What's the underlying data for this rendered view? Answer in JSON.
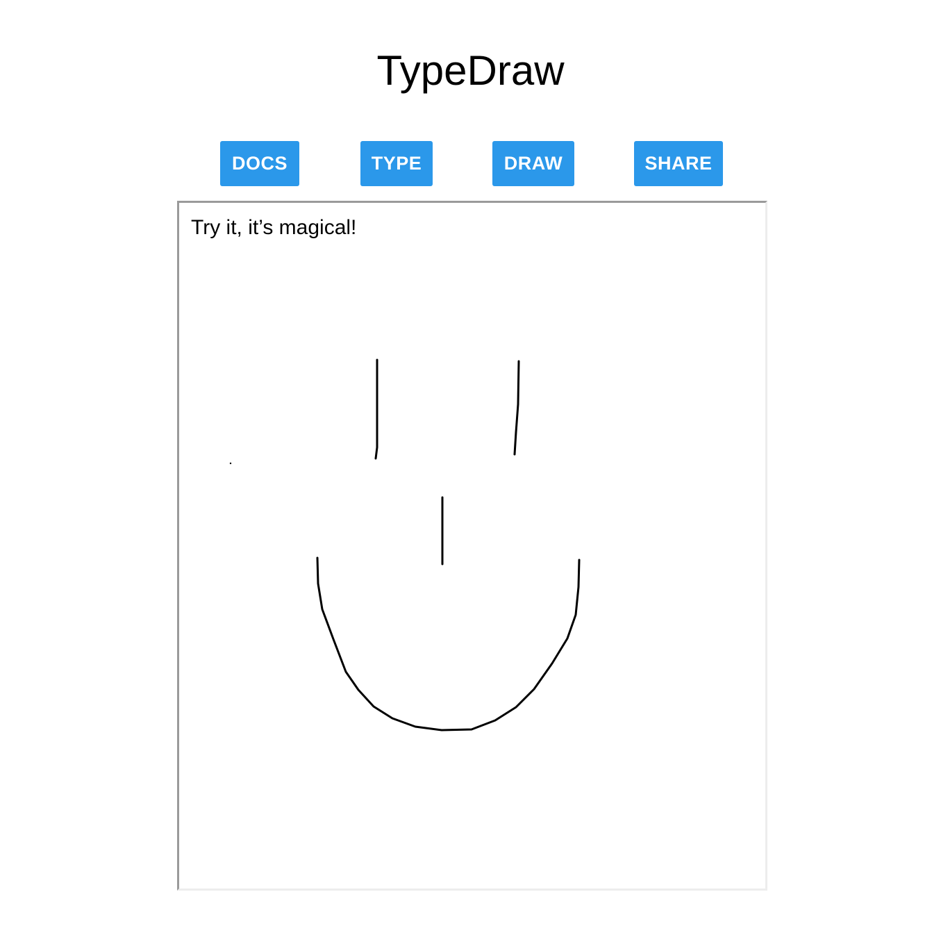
{
  "app": {
    "title": "TypeDraw"
  },
  "toolbar": {
    "docs_label": "DOCS",
    "type_label": "TYPE",
    "draw_label": "DRAW",
    "share_label": "SHARE",
    "button_color": "#2b98ea"
  },
  "editor": {
    "text": "Try it, it’s magical!"
  }
}
